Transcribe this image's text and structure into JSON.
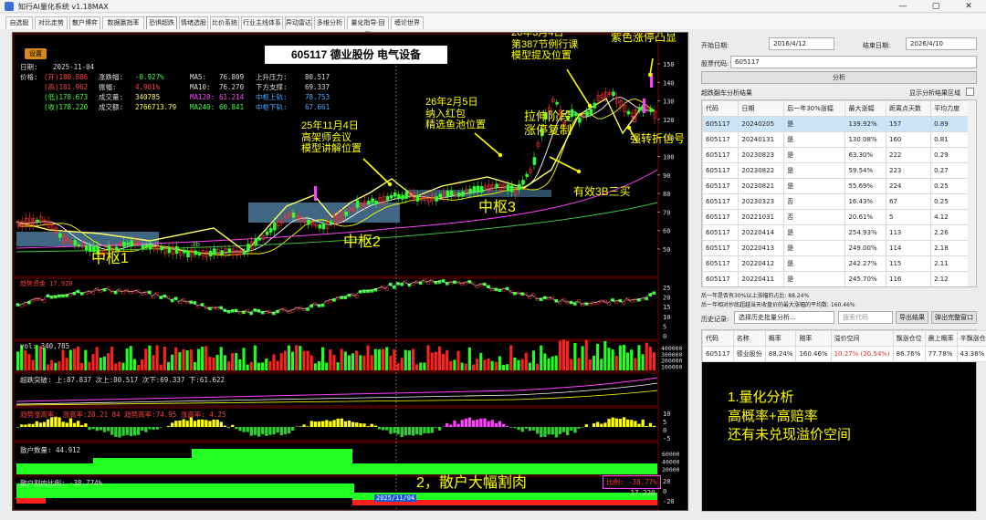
{
  "window": {
    "title": "知行AI量化系统 v1.18MAX",
    "min": "—",
    "max": "▢",
    "close": "✕"
  },
  "tabs": [
    "自选股",
    "对比走势",
    "散户博弈",
    "数据赢指率",
    "恐惧超跌",
    "情绪选股",
    "比价系统",
    "行业主线体系",
    "异动雷达",
    "多维分析",
    "量化指导·回测",
    "缠论世界"
  ],
  "active_tab": 4,
  "chart": {
    "settings_button": "设置",
    "header": "605117 德业股份 电气设备",
    "info": {
      "date_label": "日期:",
      "date": "2025-11-04",
      "price_label": "价格:",
      "open": "(开)180.886",
      "high": "(高)181.962",
      "low": "(低)178.673",
      "close": "(收)178.220",
      "change_label": "涨跌幅:",
      "change": "-0.927%",
      "amp_label": "振幅:",
      "amp": "4.901%",
      "vol_label": "成交量:",
      "vol": "340785",
      "amt_label": "成交额:",
      "amt": "2766713.79",
      "ma5_label": "MA5:",
      "ma5": "76.809",
      "ma10_label": "MA10:",
      "ma10": "76.270",
      "ma120_label": "MA120:",
      "ma120": "61.214",
      "ma240_label": "MA240:",
      "ma240": "60.841",
      "up_label": "上升压力:",
      "up": "80.517",
      "down_label": "下方支撑:",
      "down": "69.337",
      "pu_label": "中枢上轨:",
      "pu": "78.753",
      "pd_label": "中枢下轨:",
      "pd": "67.661"
    },
    "price_ticks": [
      "150",
      "140",
      "130",
      "120",
      "110",
      "100",
      "90",
      "80",
      "70",
      "60",
      "50"
    ],
    "annotations": {
      "a1": "25年11月4日\n高架师会议\n模型讲解位置",
      "a2": "26年2月5日\n纳入红包\n精选鱼池位置",
      "a3": "26年3月4日\n第387节例行课\n模型提及位置",
      "a4": "紫色涨停凸显",
      "a5": "拉伸阶段\n涨停复制",
      "a6": "强转折信号",
      "a7": "有效3B三买",
      "z1": "中枢1",
      "z2": "中枢2",
      "z3": "中枢3",
      "b_marker": "B",
      "retail_note": "2，散户大幅割肉"
    },
    "p2": {
      "label": "趋势资金 17.920",
      "ticks": [
        "25",
        "20",
        "15",
        "10",
        "5",
        "0"
      ]
    },
    "p3": {
      "label": "vol: 340,785",
      "ticks": [
        "400000",
        "300000",
        "200000",
        "100000"
      ]
    },
    "p4": {
      "label": "超跌突破: 上:87.837  次上:80.517  次下:69.337  下:61.622"
    },
    "p5": {
      "label": "趋势涨高率: 涨高率:20.21  84  趋势高率:74.95  涨高率: 4.25",
      "ticks": [
        "10",
        "5",
        "0",
        "-5"
      ]
    },
    "p6": {
      "label": "散户数量: 44.912",
      "ticks": [
        "60000",
        "40000",
        "20000"
      ]
    },
    "p7": {
      "label": "散户割肉比例: -38.774%",
      "ratio_label": "比例: -38.77%",
      "value": "-17.220",
      "ticks": [
        "20",
        "0",
        "-20"
      ],
      "date_tag": "2025/11/04"
    }
  },
  "right": {
    "start_label": "开始日期:",
    "start": "2016/4/12",
    "end_label": "结束日期:",
    "end": "2026/4/10",
    "code_label": "股票代码:",
    "code": "605117",
    "analyze": "分析",
    "results_title": "超跌翻车分析结果",
    "show_zone": "显示分析结果区域",
    "cols": [
      "代码",
      "日期",
      "后一年30%涨幅",
      "最大涨幅",
      "距离点天数",
      "平均力度"
    ],
    "rows": [
      [
        "605117",
        "20240205",
        "是",
        "139.92%",
        "157",
        "0.89"
      ],
      [
        "605117",
        "20240131",
        "是",
        "130.08%",
        "160",
        "0.81"
      ],
      [
        "605117",
        "20230823",
        "是",
        "63.30%",
        "222",
        "0.29"
      ],
      [
        "605117",
        "20230822",
        "是",
        "59.54%",
        "223",
        "0.27"
      ],
      [
        "605117",
        "20230821",
        "是",
        "55.69%",
        "224",
        "0.25"
      ],
      [
        "605117",
        "20230323",
        "否",
        "16.43%",
        "67",
        "0.25"
      ],
      [
        "605117",
        "20221031",
        "否",
        "20.61%",
        "5",
        "4.12"
      ],
      [
        "605117",
        "20220414",
        "是",
        "254.93%",
        "113",
        "2.26"
      ],
      [
        "605117",
        "20220413",
        "是",
        "249.00%",
        "114",
        "2.18"
      ],
      [
        "605117",
        "20220412",
        "是",
        "242.27%",
        "115",
        "2.11"
      ],
      [
        "605117",
        "20220411",
        "是",
        "245.70%",
        "116",
        "2.12"
      ]
    ],
    "stat1": "后一年是否有30%以上涨幅的占比:  88.24%",
    "stat2": "后一年相对抄底超越当天收盘价的最大涨幅的平均数:  160.46%",
    "hist_label": "历史记录:",
    "hist_select": "选择历史批量分析...",
    "search_ph": "搜索代码",
    "export": "导出结果",
    "popout": "弹出完整窗口",
    "cols2": [
      "代码",
      "名称",
      "概率",
      "赔率",
      "溢价空间",
      "飘涨仓位",
      "晨上概率",
      "半飘涨仓位"
    ],
    "row2": [
      "605117",
      "德业股份",
      "88.24%",
      "160.46%",
      "10.27% (20.54%)",
      "86.76%",
      "77.78%",
      "43.38%"
    ],
    "summary": "1.量化分析\n高概率+高赔率\n还有未兑现溢价空间"
  }
}
